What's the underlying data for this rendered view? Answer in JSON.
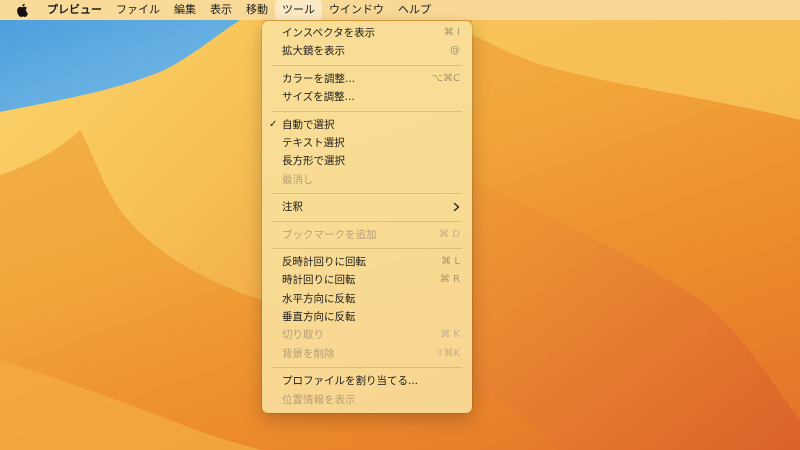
{
  "menubar": {
    "apple_icon": "apple-logo-icon",
    "app_name": "プレビュー",
    "items": [
      "ファイル",
      "編集",
      "表示",
      "移動",
      "ツール",
      "ウインドウ",
      "ヘルプ"
    ],
    "active": "ツール"
  },
  "tools_menu": {
    "items": [
      {
        "label": "インスペクタを表示",
        "shortcut": "⌘ I",
        "enabled": true
      },
      {
        "label": "拡大鏡を表示",
        "shortcut": "@",
        "enabled": true
      },
      {
        "label": "カラーを調整...",
        "shortcut": "⌥⌘C",
        "enabled": true
      },
      {
        "label": "サイズを調整...",
        "shortcut": "",
        "enabled": true
      },
      {
        "label": "自動で選択",
        "shortcut": "",
        "enabled": true,
        "checked": true
      },
      {
        "label": "テキスト選択",
        "shortcut": "",
        "enabled": true
      },
      {
        "label": "長方形で選択",
        "shortcut": "",
        "enabled": true
      },
      {
        "label": "最消し",
        "shortcut": "",
        "enabled": false
      },
      {
        "label": "注釈",
        "shortcut": "",
        "enabled": true,
        "submenu": true
      },
      {
        "label": "ブックマークを追加",
        "shortcut": "⌘ D",
        "enabled": false
      },
      {
        "label": "反時計回りに回転",
        "shortcut": "⌘ L",
        "enabled": true
      },
      {
        "label": "時計回りに回転",
        "shortcut": "⌘ R",
        "enabled": true
      },
      {
        "label": "水平方向に反転",
        "shortcut": "",
        "enabled": true
      },
      {
        "label": "垂直方向に反転",
        "shortcut": "",
        "enabled": true
      },
      {
        "label": "切り取り",
        "shortcut": "⌘ K",
        "enabled": false
      },
      {
        "label": "背景を削除",
        "shortcut": "⇧⌘K",
        "enabled": false
      },
      {
        "label": "プロファイルを割り当てる...",
        "shortcut": "",
        "enabled": true
      },
      {
        "label": "位置情報を表示",
        "shortcut": "",
        "enabled": false
      }
    ]
  }
}
